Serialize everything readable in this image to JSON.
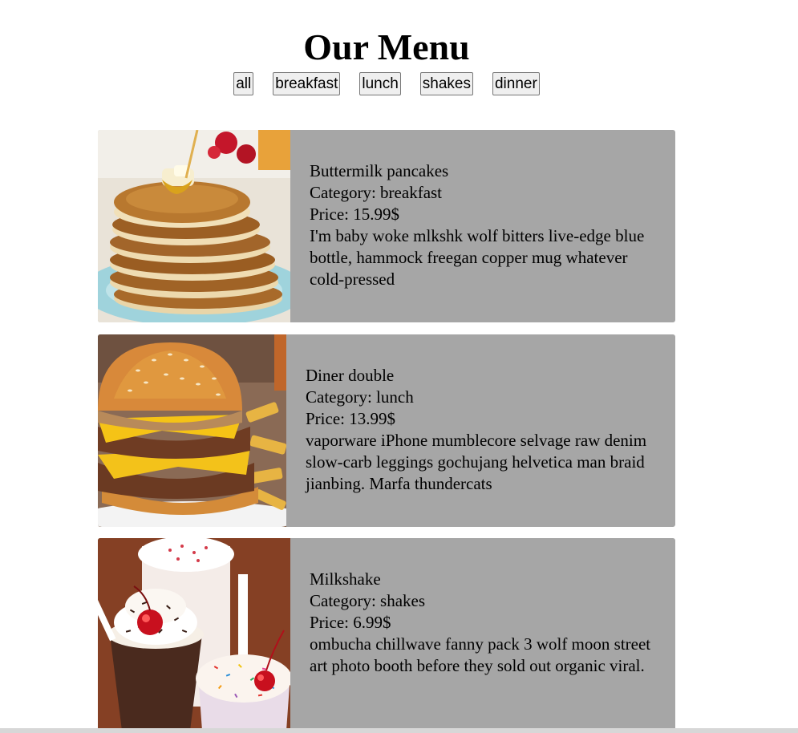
{
  "header": {
    "title": "Our Menu"
  },
  "filters": {
    "all": "all",
    "breakfast": "breakfast",
    "lunch": "lunch",
    "shakes": "shakes",
    "dinner": "dinner"
  },
  "items": [
    {
      "name": "Buttermilk pancakes",
      "category_line": "Category: breakfast",
      "price_line": "Price: 15.99$",
      "description": "I'm baby woke mlkshk wolf bitters live-edge blue bottle, hammock freegan copper mug whatever cold-pressed",
      "image": "pancakes-image"
    },
    {
      "name": "Diner double",
      "category_line": "Category: lunch",
      "price_line": "Price: 13.99$",
      "description": "vaporware iPhone mumblecore selvage raw denim slow-carb leggings gochujang helvetica man braid jianbing. Marfa thundercats",
      "image": "burger-image"
    },
    {
      "name": "Milkshake",
      "category_line": "Category: shakes",
      "price_line": "Price: 6.99$",
      "description": "ombucha chillwave fanny pack 3 wolf moon street art photo booth before they sold out organic viral.",
      "image": "milkshake-image"
    }
  ],
  "colors": {
    "card_background": "#a6a6a6",
    "page_background": "#ffffff"
  }
}
